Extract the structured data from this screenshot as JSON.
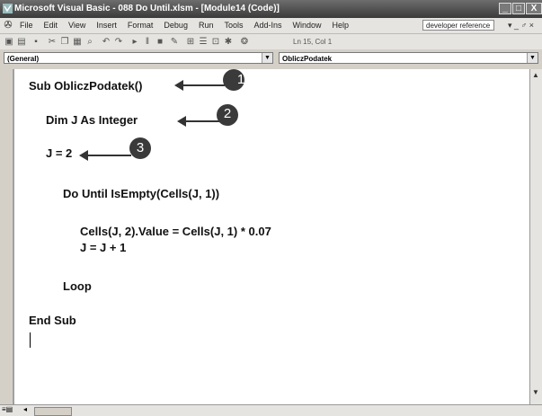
{
  "window": {
    "title": "Microsoft Visual Basic - 088 Do Until.xlsm - [Module14 (Code)]",
    "min_glyph": "_",
    "restore_glyph": "□",
    "close_glyph": "X"
  },
  "menubar": {
    "items": [
      "File",
      "Edit",
      "View",
      "Insert",
      "Format",
      "Debug",
      "Run",
      "Tools",
      "Add-Ins",
      "Window",
      "Help"
    ],
    "help_search_value": "developer reference",
    "mdi_controls": "▾ _ ♂ ×"
  },
  "toolbar": {
    "position_text": "Ln 15, Col 1"
  },
  "combos": {
    "object": "(General)",
    "procedure": "ObliczPodatek"
  },
  "code": {
    "line1": "Sub ObliczPodatek()",
    "line2": "Dim J As Integer",
    "line3": "J = 2",
    "line4": "Do Until IsEmpty(Cells(J, 1))",
    "line5": "Cells(J, 2).Value = Cells(J, 1) * 0.07",
    "line6": "J = J + 1",
    "line7": "Loop",
    "line8": "End Sub"
  },
  "callouts": [
    "1",
    "2",
    "3"
  ],
  "colors": {
    "callout_fill": "#3a3a3a",
    "titlebar": "#4a4a4a"
  }
}
